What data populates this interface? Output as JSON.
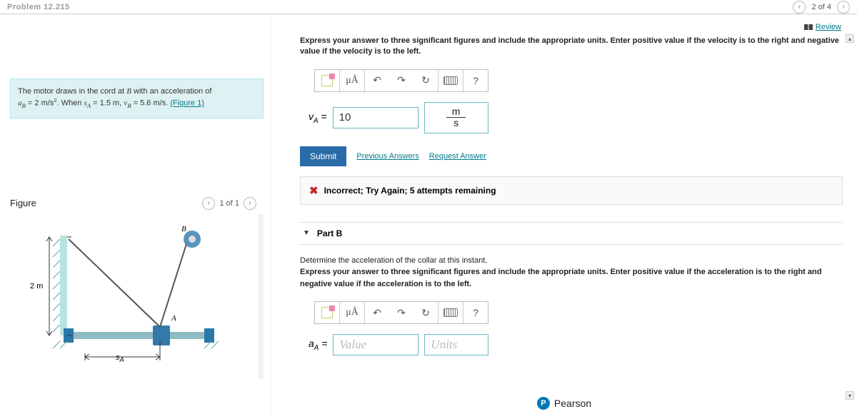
{
  "header": {
    "problem_label": "Problem 12.215",
    "counter": "2 of 4"
  },
  "review_label": "Review",
  "problem_statement": {
    "line1_pre": "The motor draws in the cord at ",
    "line1_var": "B",
    "line1_post": " with an acceleration of",
    "eq_aB": "a",
    "eq_aB_sub": "B",
    "eq_aB_val": " = 2 m/s",
    "eq_aB_sup": "2",
    "when": ". When ",
    "sA_sym": "s",
    "sA_sub": "A",
    "sA_val": " = 1.5 m, ",
    "vB_sym": "v",
    "vB_sub": "B",
    "vB_val": " = 5.6  m/s",
    "fig_ref": "(Figure 1)"
  },
  "figure": {
    "title": "Figure",
    "pager": "1 of 1",
    "dim_label": "2 m",
    "label_A": "A",
    "label_B": "B",
    "label_sA": "sA"
  },
  "partA": {
    "instruction": "Express your answer to three significant figures and include the appropriate units. Enter positive value if the velocity is to the right and negative value if the velocity is to the left.",
    "toolbar_mu": "μÅ",
    "toolbar_undo": "↶",
    "toolbar_redo": "↷",
    "toolbar_reset": "↻",
    "toolbar_help": "?",
    "var_label": "v",
    "var_sub": "A",
    "eq": " = ",
    "value": "10",
    "unit_num": "m",
    "unit_den": "s",
    "submit": "Submit",
    "prev_answers": "Previous Answers",
    "request": "Request Answer",
    "feedback": "Incorrect; Try Again; 5 attempts remaining"
  },
  "partB": {
    "header": "Part B",
    "prompt": "Determine the acceleration of the collar at this instant.",
    "instruction": "Express your answer to three significant figures and include the appropriate units. Enter positive value if the acceleration is to the right and negative value if the acceleration is to the left.",
    "var_label": "a",
    "var_sub": "A",
    "eq": " = ",
    "value_placeholder": "Value",
    "units_placeholder": "Units"
  },
  "footer": {
    "brand": "Pearson"
  }
}
